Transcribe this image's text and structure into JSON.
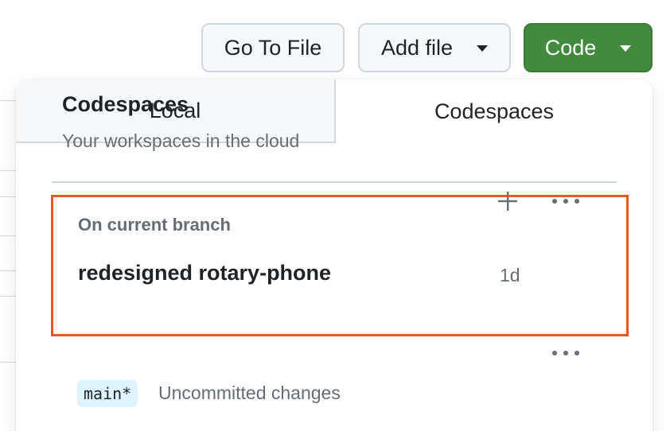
{
  "toolbar": {
    "go_to_file_label": "Go To File",
    "add_file_label": "Add file",
    "code_label": "Code"
  },
  "dropdown": {
    "tabs": [
      {
        "label": "Local",
        "selected": false
      },
      {
        "label": "Codespaces",
        "selected": true
      }
    ],
    "codespaces_header": {
      "title": "Codespaces",
      "subtitle": "Your workspaces in the cloud",
      "add_icon": "plus-icon",
      "more_icon": "kebab-horizontal-icon"
    },
    "current_branch": {
      "label": "On current branch",
      "codespace_name": "redesigned rotary-phone",
      "age": "1d",
      "branch": "main*",
      "status": "Uncommitted changes",
      "more_icon": "kebab-horizontal-icon"
    }
  },
  "colors": {
    "primary_button": "#428a3e",
    "highlight_border": "#e8572a",
    "branch_badge_bg": "#ddf4ff",
    "muted_text": "#656d76"
  }
}
